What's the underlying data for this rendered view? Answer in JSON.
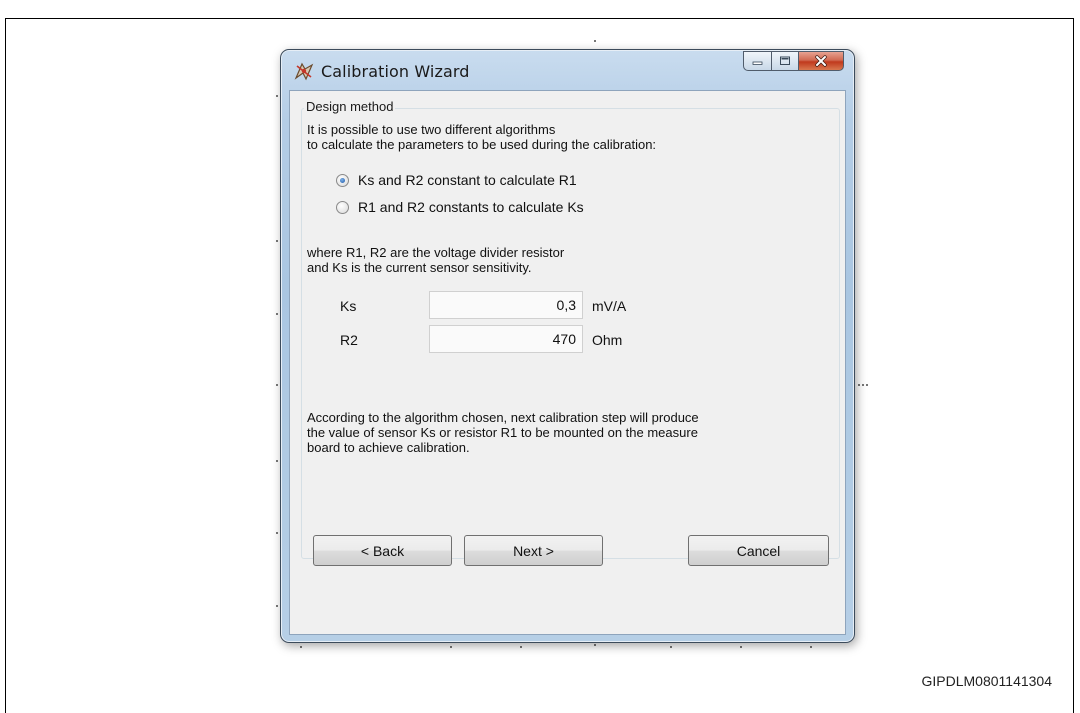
{
  "window": {
    "title": "Calibration Wizard",
    "caption_buttons": {
      "minimize_icon": "minimize-icon",
      "maximize_icon": "maximize-icon",
      "close_icon": "close-x-icon"
    }
  },
  "group": {
    "legend": "Design method",
    "intro_line1": "It is possible to use two different algorithms",
    "intro_line2": "to calculate the parameters to be used during the calibration:",
    "options": [
      {
        "label": "Ks and R2 constant to calculate R1",
        "selected": true
      },
      {
        "label": "R1 and R2 constants to calculate Ks",
        "selected": false
      }
    ],
    "note_line1": "where R1, R2 are the voltage divider resistor",
    "note_line2": "and Ks is the current sensor sensitivity.",
    "fields": [
      {
        "label": "Ks",
        "value": "0,3",
        "unit": "mV/A"
      },
      {
        "label": "R2",
        "value": "470",
        "unit": "Ohm"
      }
    ],
    "footer_line1": "According to the algorithm chosen, next calibration step will produce",
    "footer_line2": "the value of sensor Ks or resistor R1 to be mounted on the measure",
    "footer_line3": "board to achieve calibration."
  },
  "buttons": {
    "back": "< Back",
    "next": "Next >",
    "cancel": "Cancel"
  },
  "caption": "GIPDLM0801141304",
  "colors": {
    "title_glass": "#b4cde6",
    "close_button": "#c0391d",
    "client_bg": "#f0f0f0",
    "radio_dot": "#1b56a7"
  }
}
